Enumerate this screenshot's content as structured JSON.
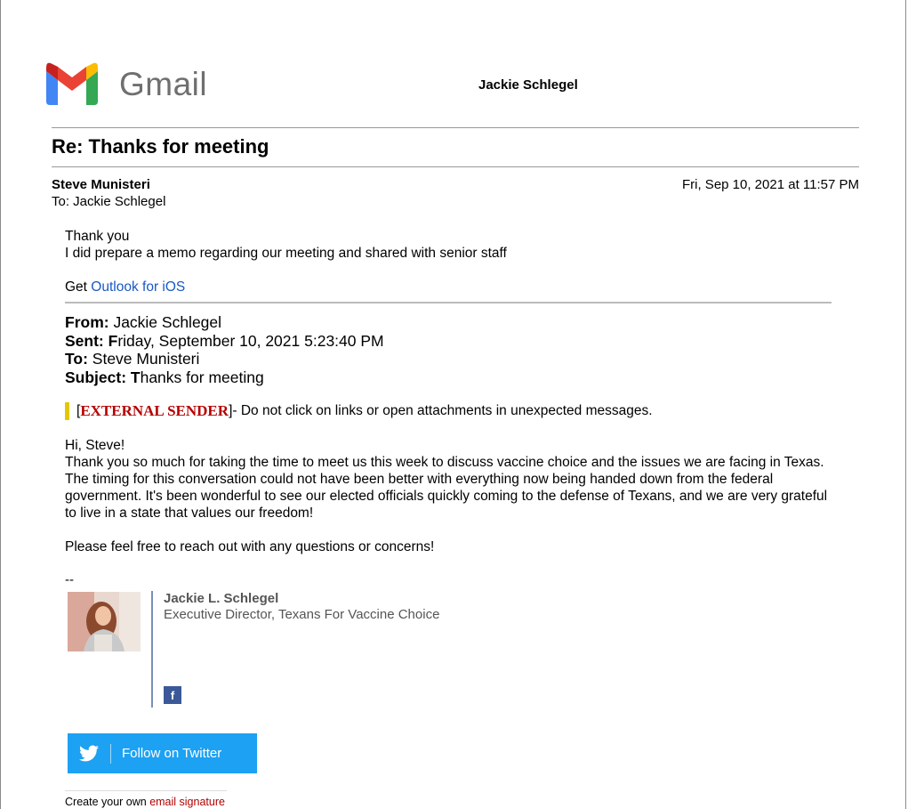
{
  "header": {
    "logo_text": "Gmail",
    "account_name": "Jackie Schlegel"
  },
  "email": {
    "subject": "Re: Thanks for meeting",
    "sender": "Steve Munisteri",
    "to_line": "To: Jackie Schlegel",
    "date": "Fri, Sep 10, 2021 at 11:57 PM",
    "reply": {
      "line1": "Thank you",
      "line2": "I did prepare a memo regarding our meeting and shared with senior staff",
      "get_prefix": "Get ",
      "outlook_link": "Outlook for iOS"
    },
    "quoted_header": {
      "from_label": "From:",
      "from_value": " Jackie Schlegel",
      "sent_label": "Sent: F",
      "sent_value": "riday, September 10, 2021 5:23:40 PM",
      "to_label": "To:",
      "to_value": " Steve Munisteri",
      "subject_label": "Subject: T",
      "subject_value": "hanks for meeting"
    },
    "warning": {
      "open": "[",
      "tag": "EXTERNAL SENDER",
      "close": "]",
      "text": " - Do not click on links or open attachments in unexpected messages."
    },
    "original": {
      "greeting": "Hi, Steve!",
      "paragraph": "Thank you so much for taking the time to meet us this week to discuss vaccine choice and the issues we are facing in Texas. The timing for this conversation could not have been better with everything now being handed down from the federal government. It's been wonderful to see our elected officials quickly coming to the defense of Texans, and we are very grateful to live in a state that values our freedom!",
      "closing": "Please feel free to reach out with any questions or concerns!",
      "dashes": "--"
    },
    "signature": {
      "name": "Jackie L. Schlegel",
      "title": "Executive Director, Texans For Vaccine Choice",
      "facebook_glyph": "f",
      "twitter_label": "Follow on Twitter",
      "create_prefix": "Create your own ",
      "create_link": "email signature"
    }
  },
  "colors": {
    "link": "#1a58c4",
    "external_tag": "#b50000",
    "warning_bar": "#e7c600",
    "twitter": "#1da1f2",
    "facebook": "#3b5998"
  }
}
